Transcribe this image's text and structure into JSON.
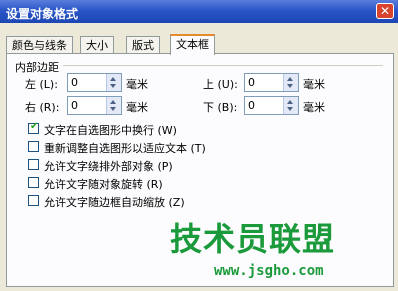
{
  "window": {
    "title": "设置对象格式",
    "close_label": "✕"
  },
  "tabs": [
    {
      "label": "颜色与线条",
      "active": false
    },
    {
      "label": "大小",
      "active": false
    },
    {
      "label": "版式",
      "active": false
    },
    {
      "label": "文本框",
      "active": true
    }
  ],
  "margins": {
    "group_label": "内部边距",
    "left": {
      "label": "左 (L):",
      "value": "0",
      "unit": "毫米"
    },
    "right": {
      "label": "右 (R):",
      "value": "0",
      "unit": "毫米"
    },
    "top": {
      "label": "上 (U):",
      "value": "0",
      "unit": "毫米"
    },
    "bottom": {
      "label": "下 (B):",
      "value": "0",
      "unit": "毫米"
    }
  },
  "options": [
    {
      "label": "文字在自选图形中换行 (W)",
      "checked": true
    },
    {
      "label": "重新调整自选图形以适应文本 (T)",
      "checked": false
    },
    {
      "label": "允许文字绕排外部对象 (P)",
      "checked": false
    },
    {
      "label": "允许文字随对象旋转 (R)",
      "checked": false
    },
    {
      "label": "允许文字随边框自动缩放 (Z)",
      "checked": false
    }
  ],
  "watermark": {
    "title": "技术员联盟",
    "url": "www.jsgho.com"
  },
  "colors": {
    "title_bar": "#2a56c8",
    "active_tab_accent": "#e68b2c",
    "watermark": "#1a9a3a"
  }
}
